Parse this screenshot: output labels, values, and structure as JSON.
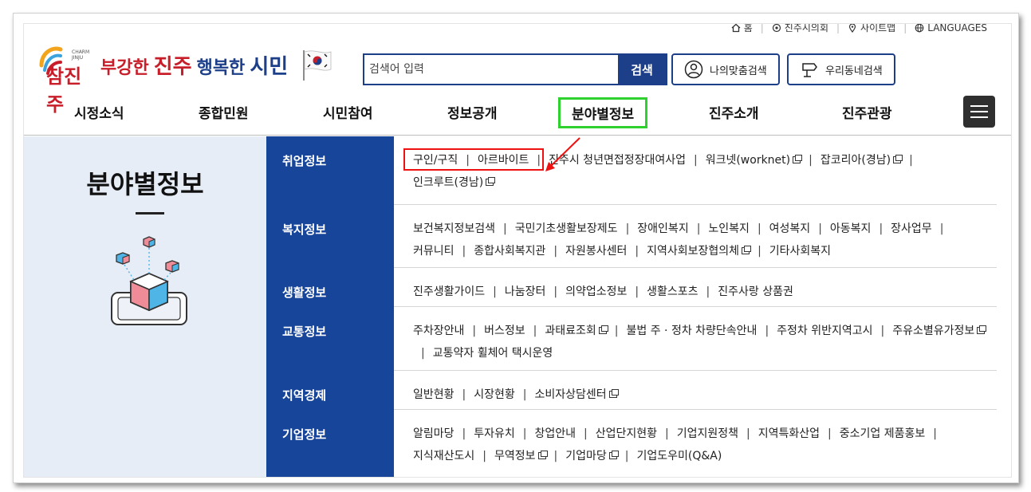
{
  "utility": {
    "home": "홈",
    "council": "진주시의회",
    "sitemap": "사이트맵",
    "languages": "LANGUAGES"
  },
  "header": {
    "logo_text": "참진주",
    "logo_small": "CHARM JINJU",
    "slogan_part1": "부강한",
    "slogan_part2": "진주",
    "slogan_part3": "행복한",
    "slogan_part4": "시민",
    "search_placeholder": "검색어 입력",
    "search_button": "검색",
    "btn_custom_search": "나의맞춤검색",
    "btn_town_search": "우리동네검색"
  },
  "gnb": {
    "items": [
      "시정소식",
      "종합민원",
      "시민참여",
      "정보공개",
      "분야별정보",
      "진주소개",
      "진주관광"
    ],
    "active_index": 4
  },
  "left_panel": {
    "title": "분야별정보"
  },
  "categories": [
    {
      "name": "취업정보",
      "links": [
        {
          "label": "구인/구직",
          "external": false
        },
        {
          "label": "아르바이트",
          "external": false
        },
        {
          "label": "진주시 청년면접정장대여사업",
          "external": false
        },
        {
          "label": "워크넷(worknet)",
          "external": true
        },
        {
          "label": "잡코리아(경남)",
          "external": true
        },
        {
          "label": "인크루트(경남)",
          "external": true
        }
      ]
    },
    {
      "name": "복지정보",
      "links": [
        {
          "label": "보건복지정보검색",
          "external": false
        },
        {
          "label": "국민기초생활보장제도",
          "external": false
        },
        {
          "label": "장애인복지",
          "external": false
        },
        {
          "label": "노인복지",
          "external": false
        },
        {
          "label": "여성복지",
          "external": false
        },
        {
          "label": "아동복지",
          "external": false
        },
        {
          "label": "장사업무",
          "external": false
        },
        {
          "label": "커뮤니티",
          "external": false
        },
        {
          "label": "종합사회복지관",
          "external": false
        },
        {
          "label": "자원봉사센터",
          "external": false
        },
        {
          "label": "지역사회보장협의체",
          "external": true
        },
        {
          "label": "기타사회복지",
          "external": false
        }
      ]
    },
    {
      "name": "생활정보",
      "links": [
        {
          "label": "진주생활가이드",
          "external": false
        },
        {
          "label": "나눔장터",
          "external": false
        },
        {
          "label": "의약업소정보",
          "external": false
        },
        {
          "label": "생활스포츠",
          "external": false
        },
        {
          "label": "진주사랑 상품권",
          "external": false
        }
      ]
    },
    {
      "name": "교통정보",
      "links": [
        {
          "label": "주차장안내",
          "external": false
        },
        {
          "label": "버스정보",
          "external": false
        },
        {
          "label": "과태료조회",
          "external": true
        },
        {
          "label": "불법 주 · 정차 차량단속안내",
          "external": false
        },
        {
          "label": "주정차 위반지역고시",
          "external": false
        },
        {
          "label": "주유소별유가정보",
          "external": true
        },
        {
          "label": "교통약자 휠체어 택시운영",
          "external": false
        }
      ]
    },
    {
      "name": "지역경제",
      "links": [
        {
          "label": "일반현황",
          "external": false
        },
        {
          "label": "시장현황",
          "external": false
        },
        {
          "label": "소비자상담센터",
          "external": true
        }
      ]
    },
    {
      "name": "기업정보",
      "links": [
        {
          "label": "알림마당",
          "external": false
        },
        {
          "label": "투자유치",
          "external": false
        },
        {
          "label": "창업안내",
          "external": false
        },
        {
          "label": "산업단지현황",
          "external": false
        },
        {
          "label": "기업지원정책",
          "external": false
        },
        {
          "label": "지역특화산업",
          "external": false
        },
        {
          "label": "중소기업 제품홍보",
          "external": false
        },
        {
          "label": "지식재산도시",
          "external": false
        },
        {
          "label": "무역정보",
          "external": true
        },
        {
          "label": "기업마당",
          "external": true
        },
        {
          "label": "기업도우미(Q&A)",
          "external": false
        }
      ]
    }
  ],
  "colors": {
    "navy": "#17459a",
    "slogan_blue": "#1d3f8a",
    "slogan_red": "#c81e2a",
    "highlight_green": "#2fd12f",
    "annotation_red": "#ee1111",
    "left_panel_bg": "#e7edf6"
  }
}
